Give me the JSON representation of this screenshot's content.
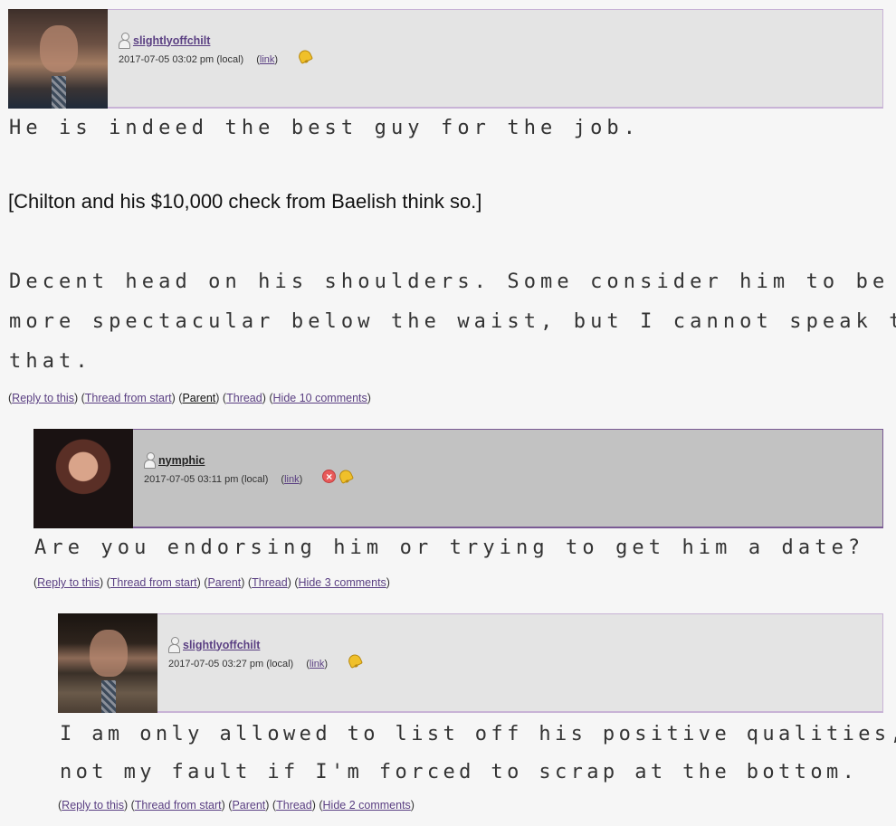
{
  "comments": [
    {
      "username": "slightlyoffchilt",
      "date": "2017-07-05 03:02 pm (local)",
      "link_label": "link",
      "paragraphs": [
        "He is indeed the best guy for the job.",
        "[Chilton and his $10,000 check from Baelish think so.]",
        "Decent head on his shoulders. Some consider him to be",
        "more spectacular below the waist, but I cannot speak to",
        "that."
      ],
      "actions": [
        "Reply to this",
        "Thread from start",
        "Parent",
        "Thread",
        "Hide 10 comments"
      ]
    },
    {
      "username": "nymphic",
      "date": "2017-07-05 03:11 pm (local)",
      "link_label": "link",
      "paragraphs": [
        "Are you endorsing him or trying to get him a date?"
      ],
      "actions": [
        "Reply to this",
        "Thread from start",
        "Parent",
        "Thread",
        "Hide 3 comments"
      ]
    },
    {
      "username": "slightlyoffchilt",
      "date": "2017-07-05 03:27 pm (local)",
      "link_label": "link",
      "paragraphs": [
        "I am only allowed to list off his positive qualities,",
        "not my fault if I'm forced to scrap at the bottom."
      ],
      "actions": [
        "Reply to this",
        "Thread from start",
        "Parent",
        "Thread",
        "Hide 2 comments"
      ]
    }
  ],
  "icons": {
    "user": "user-icon",
    "bell": "bell-icon",
    "delete": "delete-icon",
    "userpic": "userpic"
  },
  "colors": {
    "link": "#5a3f82",
    "header_gray": "#e4e4e4",
    "header_dark": "#c2c2c2",
    "bell": "#f0c02a",
    "delete": "#e85a5a"
  }
}
